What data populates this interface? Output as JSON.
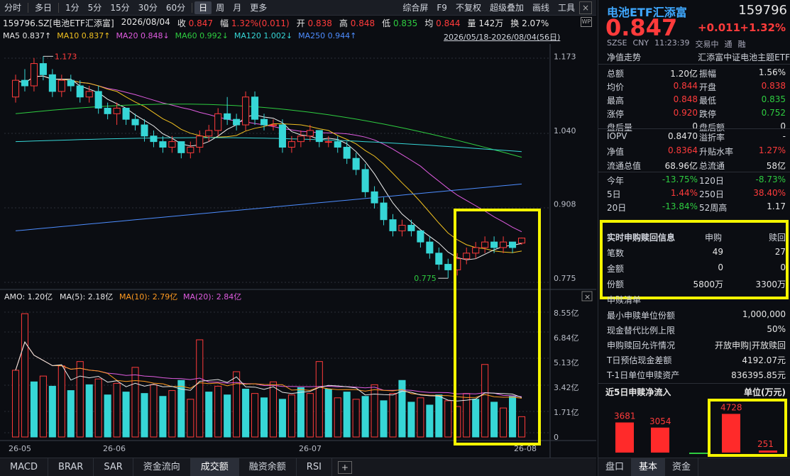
{
  "toolbar": {
    "left": [
      "分时",
      "多日",
      "1分",
      "5分",
      "15分",
      "30分",
      "60分",
      "日",
      "周",
      "月",
      "更多"
    ],
    "active": "日",
    "right": [
      "综合屏",
      "F9",
      "不复权",
      "超级叠加",
      "画线",
      "工具"
    ]
  },
  "info": {
    "code_name": "159796.SZ[电池ETF汇添富]",
    "date": "2026/08/04",
    "close_label": "收",
    "close": "0.847",
    "range_label": "幅",
    "range": "1.32%(0.011)",
    "open_label": "开",
    "open": "0.838",
    "high_label": "高",
    "high": "0.848",
    "low_label": "低",
    "low": "0.835",
    "avg_label": "均",
    "avg": "0.844",
    "vol_label": "量",
    "vol": "142万",
    "turn_label": "换",
    "turn": "2.07%"
  },
  "ma": {
    "ma5": "MA5 0.837↑",
    "ma10": "MA10 0.837↑",
    "ma20": "MA20 0.848↓",
    "ma60": "MA60 0.992↓",
    "ma120": "MA120 1.002↓",
    "ma250": "MA250 0.944↑"
  },
  "range_text": "2026/05/18-2026/08/04(56日)",
  "wp_icon": "WP",
  "chart_labels": {
    "high_marker": "1.173",
    "low_marker": "0.775",
    "price_ticks": [
      "1.173",
      "1.040",
      "0.908",
      "0.775"
    ],
    "amo_legend": {
      "amo": "AMO: 1.20亿",
      "ma5": "MA(5): 2.18亿",
      "ma10": "MA(10): 2.79亿",
      "ma20": "MA(20): 2.84亿"
    },
    "vol_ticks": [
      "8.55亿",
      "6.84亿",
      "5.13亿",
      "3.42亿",
      "1.71亿",
      "0"
    ],
    "dates": [
      "26-05",
      "26-06",
      "26-07",
      "26-08"
    ]
  },
  "chart_data": [
    {
      "type": "candlestick",
      "title": "",
      "y_axis_ticks": [
        1.173,
        1.04,
        0.908,
        0.775
      ],
      "ylim": [
        0.76,
        1.19
      ],
      "annotations": [
        {
          "text": "1.173",
          "value": 1.173
        },
        {
          "text": "0.775",
          "value": 0.775
        }
      ],
      "ohlc": [
        [
          1.1,
          1.14,
          1.09,
          1.13
        ],
        [
          1.13,
          1.15,
          1.11,
          1.12
        ],
        [
          1.12,
          1.17,
          1.11,
          1.16
        ],
        [
          1.16,
          1.173,
          1.13,
          1.14
        ],
        [
          1.14,
          1.15,
          1.1,
          1.11
        ],
        [
          1.11,
          1.14,
          1.1,
          1.13
        ],
        [
          1.13,
          1.14,
          1.11,
          1.12
        ],
        [
          1.12,
          1.13,
          1.09,
          1.1
        ],
        [
          1.1,
          1.12,
          1.09,
          1.11
        ],
        [
          1.11,
          1.12,
          1.07,
          1.08
        ],
        [
          1.08,
          1.09,
          1.06,
          1.07
        ],
        [
          1.07,
          1.09,
          1.05,
          1.08
        ],
        [
          1.08,
          1.08,
          1.05,
          1.06
        ],
        [
          1.06,
          1.07,
          1.04,
          1.05
        ],
        [
          1.05,
          1.06,
          1.02,
          1.03
        ],
        [
          1.03,
          1.04,
          1.01,
          1.02
        ],
        [
          1.02,
          1.03,
          1.0,
          1.01
        ],
        [
          1.01,
          1.03,
          1.0,
          1.02
        ],
        [
          1.02,
          1.02,
          0.99,
          1.0
        ],
        [
          1.0,
          1.02,
          0.99,
          1.01
        ],
        [
          1.01,
          1.04,
          1.0,
          1.03
        ],
        [
          1.03,
          1.05,
          1.02,
          1.04
        ],
        [
          1.04,
          1.08,
          1.03,
          1.07
        ],
        [
          1.07,
          1.1,
          1.05,
          1.06
        ],
        [
          1.06,
          1.07,
          1.04,
          1.05
        ],
        [
          1.05,
          1.11,
          1.04,
          1.1
        ],
        [
          1.1,
          1.11,
          1.05,
          1.06
        ],
        [
          1.06,
          1.07,
          1.04,
          1.05
        ],
        [
          1.05,
          1.06,
          1.04,
          1.05
        ],
        [
          1.05,
          1.06,
          1.0,
          1.01
        ],
        [
          1.01,
          1.03,
          1.0,
          1.02
        ],
        [
          1.02,
          1.04,
          1.01,
          1.03
        ],
        [
          1.03,
          1.05,
          1.02,
          1.04
        ],
        [
          1.04,
          1.04,
          1.01,
          1.02
        ],
        [
          1.02,
          1.03,
          1.01,
          1.02
        ],
        [
          1.02,
          1.03,
          1.0,
          1.01
        ],
        [
          1.01,
          1.02,
          0.98,
          0.99
        ],
        [
          0.99,
          1.0,
          0.96,
          0.97
        ],
        [
          0.97,
          0.98,
          0.92,
          0.93
        ],
        [
          0.93,
          0.94,
          0.9,
          0.91
        ],
        [
          0.91,
          0.92,
          0.87,
          0.88
        ],
        [
          0.88,
          0.89,
          0.85,
          0.86
        ],
        [
          0.86,
          0.88,
          0.85,
          0.87
        ],
        [
          0.87,
          0.88,
          0.85,
          0.86
        ],
        [
          0.86,
          0.86,
          0.83,
          0.84
        ],
        [
          0.84,
          0.85,
          0.81,
          0.82
        ],
        [
          0.82,
          0.83,
          0.79,
          0.8
        ],
        [
          0.8,
          0.81,
          0.775,
          0.79
        ],
        [
          0.79,
          0.82,
          0.78,
          0.81
        ],
        [
          0.81,
          0.83,
          0.8,
          0.82
        ],
        [
          0.82,
          0.84,
          0.81,
          0.83
        ],
        [
          0.83,
          0.85,
          0.82,
          0.84
        ],
        [
          0.84,
          0.85,
          0.82,
          0.83
        ],
        [
          0.83,
          0.85,
          0.82,
          0.84
        ],
        [
          0.84,
          0.84,
          0.82,
          0.83
        ],
        [
          0.838,
          0.848,
          0.835,
          0.847
        ]
      ],
      "series": [
        {
          "name": "MA5",
          "color": "#f0f0f0"
        },
        {
          "name": "MA10",
          "color": "#f0c020"
        },
        {
          "name": "MA20",
          "color": "#e05ce0"
        },
        {
          "name": "MA60",
          "color": "#2ecc40",
          "values_start": 1.07,
          "values_end": 0.992
        },
        {
          "name": "MA120",
          "color": "#36d6d6",
          "values_start": 1.02,
          "values_end": 1.002
        },
        {
          "name": "MA250",
          "color": "#4d8dff",
          "values_start": 0.86,
          "values_end": 0.944
        }
      ]
    },
    {
      "type": "bar",
      "title": "",
      "y_axis_ticks": [
        "8.55亿",
        "6.84亿",
        "5.13亿",
        "3.42亿",
        "1.71亿",
        "0"
      ],
      "ylim": [
        0,
        8.9
      ],
      "values": [
        4.6,
        8.5,
        3.8,
        4.2,
        3.5,
        4.9,
        3.2,
        5.2,
        3.6,
        4.0,
        2.9,
        3.7,
        3.1,
        4.8,
        3.0,
        3.6,
        2.8,
        3.2,
        3.9,
        2.6,
        6.7,
        3.1,
        3.5,
        2.9,
        4.5,
        3.3,
        3.0,
        2.7,
        3.8,
        2.6,
        2.9,
        3.4,
        3.0,
        5.2,
        3.3,
        2.7,
        3.1,
        2.6,
        2.8,
        3.6,
        2.5,
        3.0,
        3.9,
        2.4,
        2.7,
        2.2,
        2.9,
        2.5,
        2.1,
        3.0,
        2.6,
        5.0,
        2.4,
        2.0,
        2.8,
        1.4
      ],
      "up": [
        1,
        1,
        0,
        1,
        0,
        1,
        0,
        1,
        0,
        1,
        0,
        1,
        0,
        1,
        0,
        1,
        0,
        1,
        0,
        1,
        1,
        0,
        1,
        0,
        1,
        0,
        1,
        0,
        1,
        0,
        1,
        0,
        1,
        1,
        0,
        1,
        0,
        1,
        0,
        1,
        0,
        1,
        0,
        0,
        1,
        0,
        0,
        1,
        1,
        1,
        0,
        1,
        0,
        1,
        0,
        1
      ]
    }
  ],
  "bottom_tabs": [
    "MACD",
    "BRAR",
    "SAR",
    "资金流向",
    "成交额",
    "融资余额",
    "RSI"
  ],
  "bottom_active": "成交额",
  "plus": "+",
  "close_x": "×",
  "panel": {
    "name": "电池ETF汇添富",
    "code": "159796",
    "price": "0.847",
    "chg": "+0.011",
    "pct": "+1.32%",
    "sub": [
      "SZSE",
      "CNY",
      "11:23:39",
      "交易中",
      "通",
      "融"
    ],
    "trend_label": "净值走势",
    "trend_name": "汇添富中证电池主题ETF",
    "rows1": [
      {
        "k": "总额",
        "v": "1.20亿",
        "c": "white",
        "k2": "振幅",
        "v2": "1.56%",
        "c2": "white"
      },
      {
        "k": "均价",
        "v": "0.844",
        "c": "red",
        "k2": "开盘",
        "v2": "0.838",
        "c2": "red"
      },
      {
        "k": "最高",
        "v": "0.848",
        "c": "red",
        "k2": "最低",
        "v2": "0.835",
        "c2": "green"
      },
      {
        "k": "涨停",
        "v": "0.920",
        "c": "red",
        "k2": "跌停",
        "v2": "0.752",
        "c2": "green"
      },
      {
        "k": "盘后量",
        "v": "0",
        "c": "white",
        "k2": "盘后额",
        "v2": "0",
        "c2": "white"
      }
    ],
    "rows2": [
      {
        "k": "IOPV",
        "v": "0.8470",
        "c": "white",
        "k2": "溢折率",
        "v2": "-",
        "c2": "white"
      },
      {
        "k": "净值",
        "v": "0.8364",
        "c": "red",
        "k2": "升贴水率",
        "v2": "1.27%",
        "c2": "red"
      },
      {
        "k": "流通总值",
        "v": "68.96亿",
        "c": "white",
        "k2": "总流通",
        "v2": "58亿",
        "c2": "white"
      }
    ],
    "rows3": [
      {
        "k": "今年",
        "v": "-13.75%",
        "c": "green",
        "k2": "120日",
        "v2": "-8.73%",
        "c2": "green"
      },
      {
        "k": "5日",
        "v": "1.44%",
        "c": "red",
        "k2": "250日",
        "v2": "38.40%",
        "c2": "red"
      },
      {
        "k": "20日",
        "v": "-13.84%",
        "c": "green",
        "k2": "52周高",
        "v2": "1.17",
        "c2": "white"
      }
    ],
    "sub_table": {
      "title": "实时申购赎回信息",
      "col1": "申购",
      "col2": "赎回",
      "rows": [
        {
          "k": "笔数",
          "a": "49",
          "b": "27"
        },
        {
          "k": "金额",
          "a": "0",
          "b": "0"
        },
        {
          "k": "份额",
          "a": "5800万",
          "b": "3300万"
        }
      ]
    },
    "list_title": "申赎清单",
    "list": [
      {
        "k": "最小申赎单位份额",
        "v": "1,000,000"
      },
      {
        "k": "现金替代比例上限",
        "v": "50%"
      },
      {
        "k": "申购赎回允许情况",
        "v": "开放申购|开放赎回"
      },
      {
        "k": "T日预估现金差额",
        "v": "4192.07元"
      },
      {
        "k": "T-1日单位申赎资产",
        "v": "836395.85元"
      }
    ],
    "flow_title": "近5日申赎净流入",
    "flow_unit": "单位(万元)",
    "flow_chart": {
      "type": "bar",
      "values": [
        3681,
        3054,
        0,
        4728,
        251
      ],
      "labels": [
        "3681",
        "3054",
        "",
        "4728",
        "251"
      ]
    },
    "tabs": [
      "盘口",
      "基本",
      "资金"
    ],
    "tab_active": "基本"
  }
}
